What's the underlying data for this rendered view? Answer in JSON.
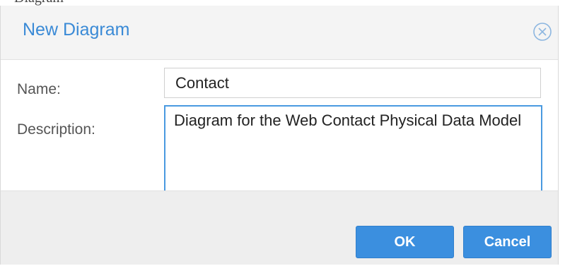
{
  "dialog": {
    "title": "New Diagram",
    "close_icon": "circle-x-icon"
  },
  "form": {
    "name_label": "Name:",
    "name_value": "Contact",
    "description_label": "Description:",
    "description_value": "Diagram for the Web Contact Physical Data Model"
  },
  "footer": {
    "ok_label": "OK",
    "cancel_label": "Cancel"
  },
  "colors": {
    "title": "#3a8ad6",
    "button": "#3b8fdf",
    "focus_border": "#4a9ae0",
    "header_bg": "#f4f4f4",
    "footer_bg": "#eeeeee"
  }
}
